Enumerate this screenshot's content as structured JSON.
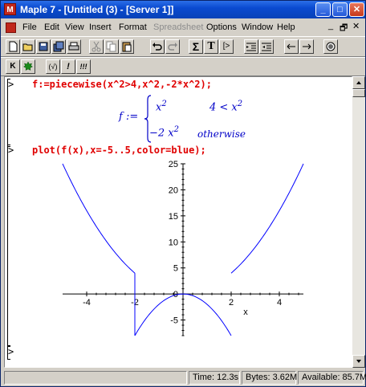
{
  "window": {
    "title": "Maple 7 - [Untitled (3) - [Server 1]]",
    "app_icon": "M",
    "controls": {
      "minimize": "_",
      "maximize": "□",
      "close": "✕"
    }
  },
  "menubar": {
    "items": [
      {
        "label": "File",
        "enabled": true
      },
      {
        "label": "Edit",
        "enabled": true
      },
      {
        "label": "View",
        "enabled": true
      },
      {
        "label": "Insert",
        "enabled": true
      },
      {
        "label": "Format",
        "enabled": true
      },
      {
        "label": "Spreadsheet",
        "enabled": false
      },
      {
        "label": "Options",
        "enabled": true
      },
      {
        "label": "Window",
        "enabled": true
      },
      {
        "label": "Help",
        "enabled": true
      }
    ],
    "doc_controls": {
      "minimize": "_",
      "restore": "🗗",
      "close": "✕"
    }
  },
  "toolbar2": {
    "labels": {
      "sigma": "Σ",
      "text": "T",
      "prompt": "[>"
    }
  },
  "context_bar": {
    "labels": {
      "k": "K",
      "vars": "(√)",
      "excl": "!",
      "excl3": "!!!"
    }
  },
  "worksheet": {
    "prompt": ">",
    "input1": "f:=piecewise(x^2>4,x^2,-2*x^2);",
    "output1": {
      "lhs": "f :=",
      "case1_expr": "x",
      "case1_exp": "2",
      "case1_cond": "4 < x",
      "case1_cond_exp": "2",
      "case2_expr": "−2 x",
      "case2_exp": "2",
      "case2_cond": "otherwise"
    },
    "input2": "plot(f(x),x=-5..5,color=blue);",
    "prompt3": ">"
  },
  "chart_data": {
    "type": "line",
    "color": "#0000ff",
    "xlim": [
      -5,
      5
    ],
    "ylim": [
      -8,
      25
    ],
    "xlabel": "x",
    "ylabel": "",
    "x_ticks": [
      -4,
      -2,
      0,
      2,
      4
    ],
    "y_ticks": [
      -5,
      0,
      5,
      10,
      15,
      20,
      25
    ],
    "grid": false,
    "legend": "none",
    "pieces": [
      {
        "name": "",
        "expr": "x^2",
        "x": [
          -5,
          -2
        ]
      },
      {
        "name": "",
        "expr": "-2*x^2",
        "x": [
          -2,
          2
        ]
      },
      {
        "name": "",
        "expr": "x^2",
        "x": [
          2,
          5
        ]
      }
    ],
    "verticals": [
      {
        "x": -2,
        "y": [
          -8,
          4
        ]
      }
    ]
  },
  "statusbar": {
    "time": "Time: 12.3s",
    "bytes": "Bytes: 3.62M",
    "available": "Available: 85.7M"
  }
}
